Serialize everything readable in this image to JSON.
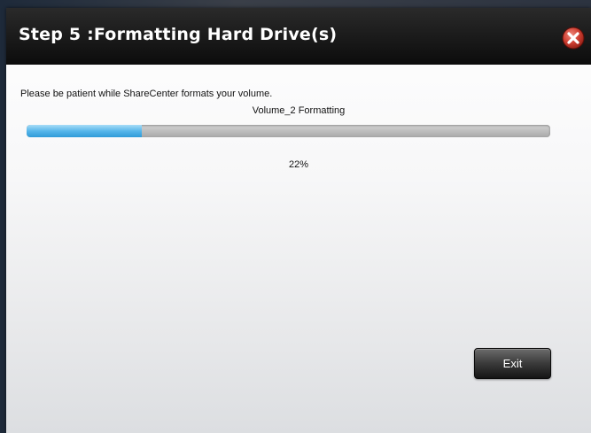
{
  "dialog": {
    "title": "Step 5 :Formatting Hard Drive(s)",
    "close_icon": "close-icon",
    "message": "Please be patient while ShareCenter formats your volume.",
    "progress": {
      "label": "Volume_2 Formatting",
      "value": 22,
      "percent_text": "22%"
    },
    "exit_label": "Exit"
  },
  "colors": {
    "titlebar": "#111111",
    "progress_fill": "#56b6ea",
    "close_button": "#c0392b"
  }
}
